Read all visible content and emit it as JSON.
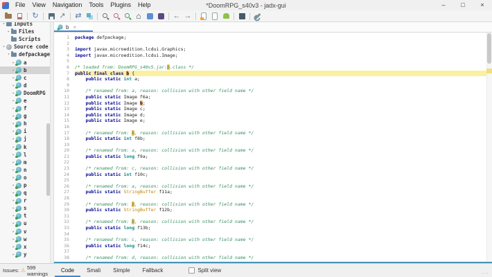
{
  "window": {
    "title": "*DoomRPG_s40v3 - jadx-gui",
    "minimize": "–",
    "maximize": "□",
    "close": "×"
  },
  "menu": [
    "File",
    "View",
    "Navigation",
    "Tools",
    "Plugins",
    "Help"
  ],
  "toolbar": {
    "icons": [
      "open-file",
      "add-files",
      "reload",
      "save-all",
      "export",
      "sync-with-editor",
      "flat-packages",
      "text-search",
      "class-search",
      "comment-search",
      "main-activity",
      "java-panel",
      "smali-panel",
      "navigate-back",
      "navigate-forward",
      "deobfuscation",
      "adb-debug",
      "quark-analysis",
      "log-viewer",
      "preferences"
    ]
  },
  "sidebar": {
    "items": [
      {
        "label": "Inputs",
        "depth": 0,
        "icon": "folder",
        "chevron": "open"
      },
      {
        "label": "Files",
        "depth": 1,
        "icon": "folder",
        "chevron": "closed"
      },
      {
        "label": "Scripts",
        "depth": 1,
        "icon": "folder",
        "chevron": "none"
      },
      {
        "label": "Source code",
        "depth": 0,
        "icon": "source",
        "chevron": "open"
      },
      {
        "label": "defpackage",
        "depth": 1,
        "icon": "folder",
        "chevron": "open"
      },
      {
        "label": "a",
        "depth": 2,
        "icon": "class",
        "chevron": "closed"
      },
      {
        "label": "b",
        "depth": 2,
        "icon": "class",
        "chevron": "closed",
        "selected": true
      },
      {
        "label": "c",
        "depth": 2,
        "icon": "class",
        "chevron": "closed"
      },
      {
        "label": "d",
        "depth": 2,
        "icon": "class",
        "chevron": "closed"
      },
      {
        "label": "DoomRPG",
        "depth": 2,
        "icon": "class",
        "chevron": "closed"
      },
      {
        "label": "e",
        "depth": 2,
        "icon": "class",
        "chevron": "closed"
      },
      {
        "label": "f",
        "depth": 2,
        "icon": "class",
        "chevron": "closed"
      },
      {
        "label": "g",
        "depth": 2,
        "icon": "class",
        "chevron": "closed"
      },
      {
        "label": "h",
        "depth": 2,
        "icon": "class",
        "chevron": "closed"
      },
      {
        "label": "i",
        "depth": 2,
        "icon": "class",
        "chevron": "closed"
      },
      {
        "label": "j",
        "depth": 2,
        "icon": "class",
        "chevron": "closed"
      },
      {
        "label": "k",
        "depth": 2,
        "icon": "class",
        "chevron": "closed"
      },
      {
        "label": "l",
        "depth": 2,
        "icon": "class",
        "chevron": "closed"
      },
      {
        "label": "m",
        "depth": 2,
        "icon": "class",
        "chevron": "closed"
      },
      {
        "label": "n",
        "depth": 2,
        "icon": "class",
        "chevron": "closed"
      },
      {
        "label": "o",
        "depth": 2,
        "icon": "class",
        "chevron": "closed"
      },
      {
        "label": "p",
        "depth": 2,
        "icon": "class",
        "chevron": "closed"
      },
      {
        "label": "q",
        "depth": 2,
        "icon": "class",
        "chevron": "closed"
      },
      {
        "label": "r",
        "depth": 2,
        "icon": "class",
        "chevron": "closed"
      },
      {
        "label": "s",
        "depth": 2,
        "icon": "class",
        "chevron": "closed"
      },
      {
        "label": "t",
        "depth": 2,
        "icon": "class",
        "chevron": "closed"
      },
      {
        "label": "u",
        "depth": 2,
        "icon": "class",
        "chevron": "closed"
      },
      {
        "label": "v",
        "depth": 2,
        "icon": "class",
        "chevron": "closed"
      },
      {
        "label": "w",
        "depth": 2,
        "icon": "class",
        "chevron": "closed"
      },
      {
        "label": "x",
        "depth": 2,
        "icon": "class",
        "chevron": "closed"
      },
      {
        "label": "y",
        "depth": 2,
        "icon": "class",
        "chevron": "closed"
      }
    ]
  },
  "editor": {
    "tab": {
      "label": "b",
      "close": "×"
    },
    "lines": [
      {
        "n": 1,
        "seg": [
          [
            "kw",
            "package"
          ],
          [
            "pl",
            " defpackage;"
          ]
        ]
      },
      {
        "n": 2,
        "seg": []
      },
      {
        "n": 3,
        "seg": [
          [
            "kw",
            "import"
          ],
          [
            "pl",
            " javax.microedition.lcdui.Graphics;"
          ]
        ]
      },
      {
        "n": 4,
        "seg": [
          [
            "kw",
            "import"
          ],
          [
            "pl",
            " javax.microedition.lcdui.Image;"
          ]
        ]
      },
      {
        "n": 5,
        "seg": []
      },
      {
        "n": 6,
        "seg": [
          [
            "cm",
            "/* loaded from: DoomRPG_s40v5.jar:"
          ],
          [
            "cmhl",
            "b"
          ],
          [
            "cm",
            ".class */"
          ]
        ]
      },
      {
        "n": 7,
        "cur": true,
        "seg": [
          [
            "kw",
            "public final class"
          ],
          [
            "pl",
            " "
          ],
          [
            "hl",
            "b"
          ],
          [
            "pl",
            " {"
          ]
        ]
      },
      {
        "n": 8,
        "seg": [
          [
            "pl",
            "    "
          ],
          [
            "kw",
            "public static"
          ],
          [
            "pl",
            " "
          ],
          [
            "ty",
            "int"
          ],
          [
            "pl",
            " a;"
          ]
        ]
      },
      {
        "n": 9,
        "seg": []
      },
      {
        "n": 10,
        "seg": [
          [
            "pl",
            "    "
          ],
          [
            "cm",
            "/* renamed from: a, reason: collision with other field name */"
          ]
        ]
      },
      {
        "n": 11,
        "seg": [
          [
            "pl",
            "    "
          ],
          [
            "kw",
            "public static"
          ],
          [
            "pl",
            " Image f6a;"
          ]
        ]
      },
      {
        "n": 12,
        "seg": [
          [
            "pl",
            "    "
          ],
          [
            "kw",
            "public static"
          ],
          [
            "pl",
            " Image "
          ],
          [
            "hl",
            "b"
          ],
          [
            "pl",
            ";"
          ]
        ]
      },
      {
        "n": 13,
        "seg": [
          [
            "pl",
            "    "
          ],
          [
            "kw",
            "public static"
          ],
          [
            "pl",
            " Image c;"
          ]
        ]
      },
      {
        "n": 14,
        "seg": [
          [
            "pl",
            "    "
          ],
          [
            "kw",
            "public static"
          ],
          [
            "pl",
            " Image d;"
          ]
        ]
      },
      {
        "n": 15,
        "seg": [
          [
            "pl",
            "    "
          ],
          [
            "kw",
            "public static"
          ],
          [
            "pl",
            " Image e;"
          ]
        ]
      },
      {
        "n": 16,
        "seg": []
      },
      {
        "n": 17,
        "seg": [
          [
            "pl",
            "    "
          ],
          [
            "cm",
            "/* renamed from: "
          ],
          [
            "cmhl",
            "b"
          ],
          [
            "cm",
            ", reason: collision with other field name */"
          ]
        ]
      },
      {
        "n": 18,
        "seg": [
          [
            "pl",
            "    "
          ],
          [
            "kw",
            "public static"
          ],
          [
            "pl",
            " "
          ],
          [
            "ty",
            "int"
          ],
          [
            "pl",
            " f8b;"
          ]
        ]
      },
      {
        "n": 19,
        "seg": []
      },
      {
        "n": 20,
        "seg": [
          [
            "pl",
            "    "
          ],
          [
            "cm",
            "/* renamed from: a, reason: collision with other field name */"
          ]
        ]
      },
      {
        "n": 21,
        "seg": [
          [
            "pl",
            "    "
          ],
          [
            "kw",
            "public static"
          ],
          [
            "pl",
            " "
          ],
          [
            "ty",
            "long"
          ],
          [
            "pl",
            " f9a;"
          ]
        ]
      },
      {
        "n": 22,
        "seg": []
      },
      {
        "n": 23,
        "seg": [
          [
            "pl",
            "    "
          ],
          [
            "cm",
            "/* renamed from: c, reason: collision with other field name */"
          ]
        ]
      },
      {
        "n": 24,
        "seg": [
          [
            "pl",
            "    "
          ],
          [
            "kw",
            "public static"
          ],
          [
            "pl",
            " "
          ],
          [
            "ty",
            "int"
          ],
          [
            "pl",
            " f10c;"
          ]
        ]
      },
      {
        "n": 25,
        "seg": []
      },
      {
        "n": 26,
        "seg": [
          [
            "pl",
            "    "
          ],
          [
            "cm",
            "/* renamed from: a, reason: collision with other field name */"
          ]
        ]
      },
      {
        "n": 27,
        "seg": [
          [
            "pl",
            "    "
          ],
          [
            "kw",
            "public static"
          ],
          [
            "pl",
            " "
          ],
          [
            "cl",
            "StringBuffer"
          ],
          [
            "pl",
            " f11a;"
          ]
        ]
      },
      {
        "n": 28,
        "seg": []
      },
      {
        "n": 29,
        "seg": [
          [
            "pl",
            "    "
          ],
          [
            "cm",
            "/* renamed from: "
          ],
          [
            "cmhl",
            "b"
          ],
          [
            "cm",
            ", reason: collision with other field name */"
          ]
        ]
      },
      {
        "n": 30,
        "seg": [
          [
            "pl",
            "    "
          ],
          [
            "kw",
            "public static"
          ],
          [
            "pl",
            " "
          ],
          [
            "cl",
            "StringBuffer"
          ],
          [
            "pl",
            " f12b;"
          ]
        ]
      },
      {
        "n": 31,
        "seg": []
      },
      {
        "n": 32,
        "seg": [
          [
            "pl",
            "    "
          ],
          [
            "cm",
            "/* renamed from: "
          ],
          [
            "cmhl",
            "b"
          ],
          [
            "cm",
            ", reason: collision with other field name */"
          ]
        ]
      },
      {
        "n": 33,
        "seg": [
          [
            "pl",
            "    "
          ],
          [
            "kw",
            "public static"
          ],
          [
            "pl",
            " "
          ],
          [
            "ty",
            "long"
          ],
          [
            "pl",
            " f13b;"
          ]
        ]
      },
      {
        "n": 34,
        "seg": []
      },
      {
        "n": 35,
        "seg": [
          [
            "pl",
            "    "
          ],
          [
            "cm",
            "/* renamed from: c, reason: collision with other field name */"
          ]
        ]
      },
      {
        "n": 36,
        "seg": [
          [
            "pl",
            "    "
          ],
          [
            "kw",
            "public static"
          ],
          [
            "pl",
            " "
          ],
          [
            "ty",
            "long"
          ],
          [
            "pl",
            " f14c;"
          ]
        ]
      },
      {
        "n": 37,
        "seg": []
      },
      {
        "n": 38,
        "seg": [
          [
            "pl",
            "    "
          ],
          [
            "cm",
            "/* renamed from: d, reason: collision with other field name */"
          ]
        ]
      }
    ]
  },
  "statusbar": {
    "issues_label": "Issues:",
    "issues_count": "599 warnings",
    "tabs": [
      "Code",
      "Smali",
      "Simple",
      "Fallback"
    ],
    "active_tab": "Code",
    "split_view_label": "Split view",
    "split_view_checked": false
  },
  "colors": {
    "accent": "#3f86ce",
    "current_line": "#faf0a0",
    "token_highlight": "#f6bf50",
    "keyword": "#00008c",
    "comment": "#379162",
    "warning": "#e8a33d"
  }
}
